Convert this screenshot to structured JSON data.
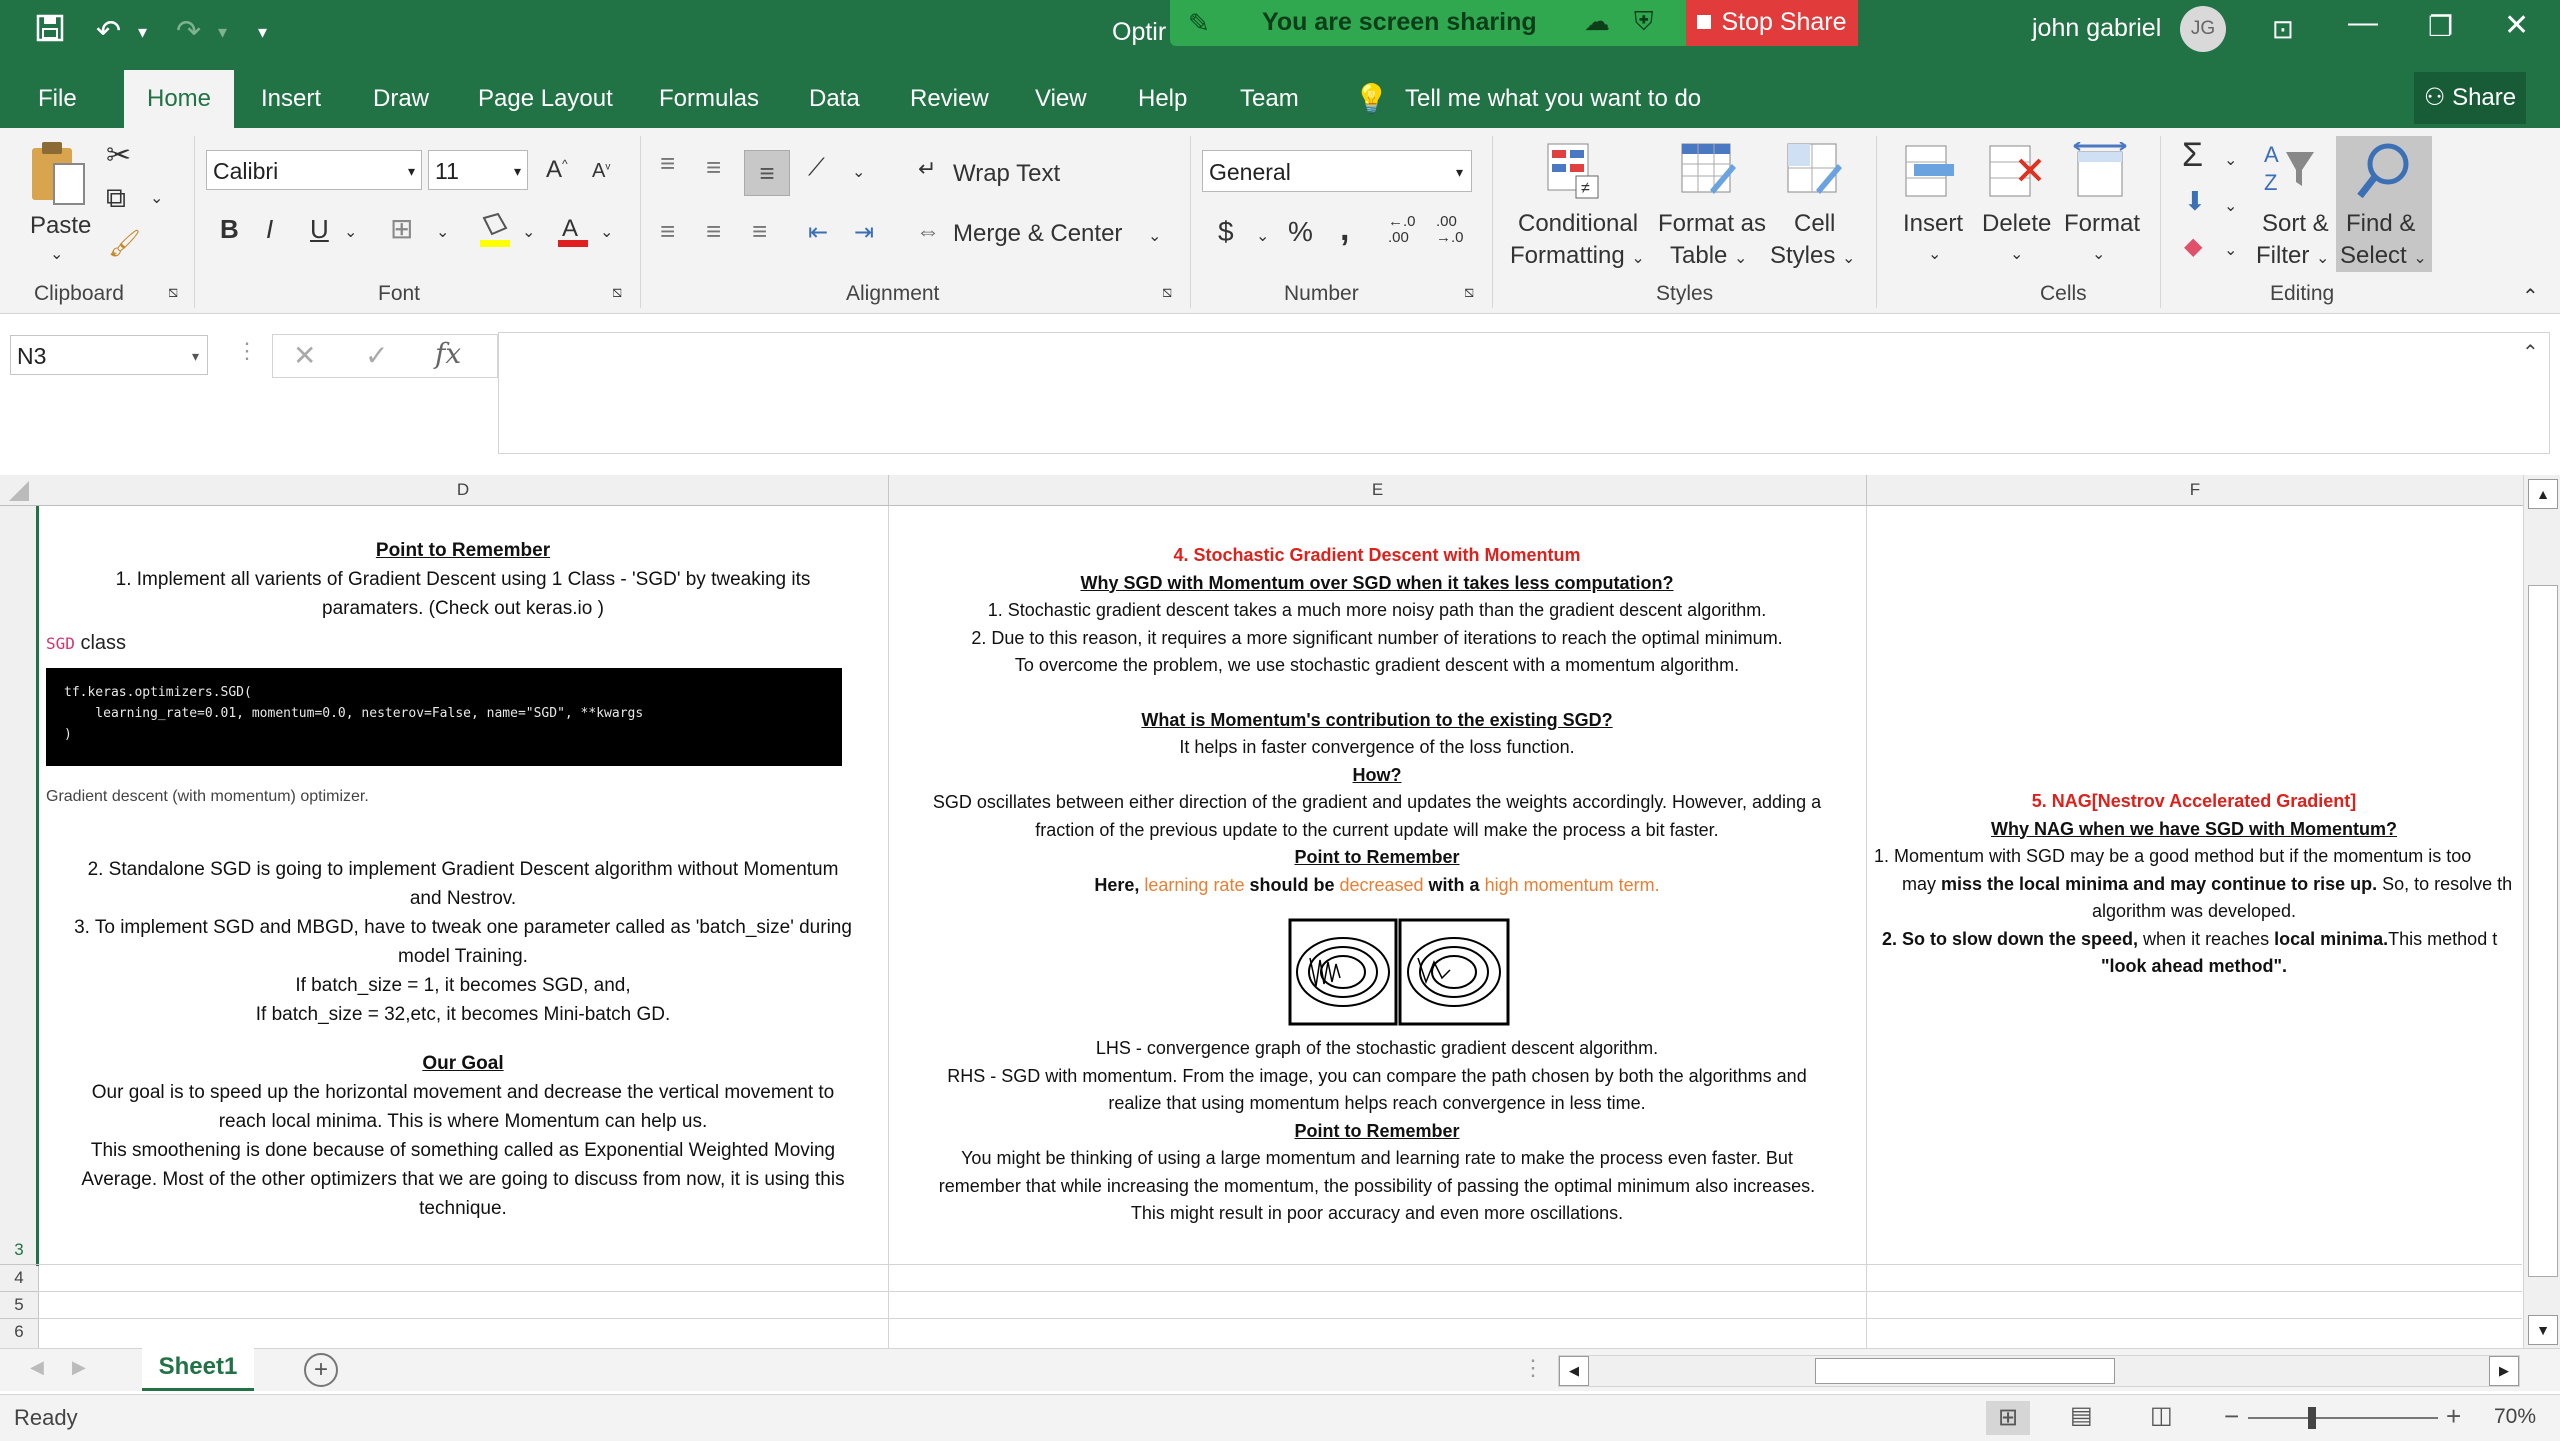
{
  "titlebar": {
    "title_partial": "Optir",
    "sharing_text": "You are screen sharing",
    "stop_share": "Stop Share",
    "user_name": "john gabriel",
    "user_initials": "JG"
  },
  "tabs": [
    "File",
    "Home",
    "Insert",
    "Draw",
    "Page Layout",
    "Formulas",
    "Data",
    "Review",
    "View",
    "Help",
    "Team"
  ],
  "tell_me": "Tell me what you want to do",
  "share_label": "Share",
  "ribbon": {
    "clipboard": {
      "paste": "Paste",
      "label": "Clipboard"
    },
    "font": {
      "name": "Calibri",
      "size": "11",
      "label": "Font",
      "bold": "B",
      "italic": "I",
      "underline": "U"
    },
    "alignment": {
      "wrap": "Wrap Text",
      "merge": "Merge & Center",
      "label": "Alignment"
    },
    "number": {
      "format": "General",
      "currency": "$",
      "percent": "%",
      "comma": ",",
      "label": "Number"
    },
    "styles": {
      "conditional1": "Conditional",
      "conditional2": "Formatting",
      "table1": "Format as",
      "table2": "Table",
      "cell1": "Cell",
      "cell2": "Styles",
      "label": "Styles"
    },
    "cells": {
      "insert": "Insert",
      "delete": "Delete",
      "format": "Format",
      "label": "Cells"
    },
    "editing": {
      "sort1": "Sort &",
      "sort2": "Filter",
      "find1": "Find &",
      "find2": "Select",
      "label": "Editing"
    }
  },
  "formula_bar": {
    "name_box": "N3",
    "fx": "fx",
    "value": ""
  },
  "columns": [
    "D",
    "E",
    "F"
  ],
  "rows": [
    "3",
    "4",
    "5",
    "6"
  ],
  "cellD": {
    "head": "Point to Remember",
    "p1": "1. Implement all varients of Gradient Descent using 1 Class - 'SGD' by tweaking its",
    "p1b": "paramaters. (Check out keras.io )",
    "sgd_tag": "SGD",
    "sgd_class": "class",
    "code1": "tf.keras.optimizers.SGD(",
    "code2": "    learning_rate=0.01, momentum=0.0, nesterov=False, name=\"SGD\", **kwargs",
    "code3": ")",
    "caption": "Gradient descent (with momentum) optimizer.",
    "p2a": "2. Standalone SGD is going to implement Gradient Descent algorithm without Momentum",
    "p2b": "and Nestrov.",
    "p3a": "3. To implement SGD and MBGD, have to tweak one parameter called as 'batch_size' during",
    "p3b": "model Training.",
    "p4": "If batch_size = 1, it becomes SGD, and,",
    "p5": "If batch_size = 32,etc, it becomes Mini-batch GD.",
    "goal": "Our Goal",
    "g1": "Our goal is to speed up the horizontal movement and decrease the vertical movement to",
    "g2": "reach local minima. This is where Momentum can help us.",
    "g3": "This smoothening is done because of something called as Exponential Weighted Moving",
    "g4": "Average. Most of the other optimizers that we are going to discuss from now, it is using this",
    "g5": "technique."
  },
  "cellE": {
    "title": "4. Stochastic Gradient Descent with Momentum",
    "q1": "Why SGD with Momentum over SGD when it takes less computation?",
    "a1": "1. Stochastic gradient descent takes a much more noisy path than the gradient descent algorithm.",
    "a2": "2. Due to this reason, it requires a more significant number of iterations to reach the optimal minimum.",
    "a3": "To overcome the problem, we use stochastic gradient descent with a momentum algorithm.",
    "q2": "What is Momentum's contribution to the existing SGD?",
    "a4": "It helps in faster convergence of the loss function.",
    "how": "How?",
    "a5": "SGD oscillates between either direction of the gradient and updates the weights accordingly. However, adding a",
    "a6": "fraction of the previous update to the current update will make the process a bit faster.",
    "ptr": "Point to Remember",
    "a7_pre": "Here, ",
    "a7_lr": "learning rate",
    "a7_mid": " should be ",
    "a7_dec": "decreased",
    "a7_with": " with a ",
    "a7_high": "high momentum term.",
    "c1": "LHS - convergence graph of the stochastic gradient descent algorithm.",
    "c2": "RHS - SGD with momentum. From the image, you can compare the path chosen by both the algorithms and",
    "c3": "realize that using momentum helps reach convergence in less time.",
    "ptr2": "Point to Remember",
    "c4": "You might be thinking of using a large momentum and learning rate to make the process even faster. But",
    "c5": "remember that while increasing the momentum, the possibility of passing the optimal minimum also increases.",
    "c6": "This might result in poor accuracy and even more oscillations."
  },
  "cellF": {
    "title": "5. NAG[Nestrov Accelerated Gradient]",
    "q": "Why NAG when we have SGD with Momentum?",
    "l1": "1. Momentum with SGD may be a good method but if the momentum is too",
    "l2a": "may ",
    "l2b": "miss the local minima and may continue to rise up.",
    "l2c": " So, to resolve th",
    "l3": "algorithm was developed.",
    "l4a": "2. So to slow down the speed,",
    "l4b": " when it reaches ",
    "l4c": "local minima.",
    "l4d": "This method t",
    "l5": "\"look ahead method\"."
  },
  "sheet": {
    "name": "Sheet1"
  },
  "status": {
    "ready": "Ready",
    "zoom": "70%"
  }
}
